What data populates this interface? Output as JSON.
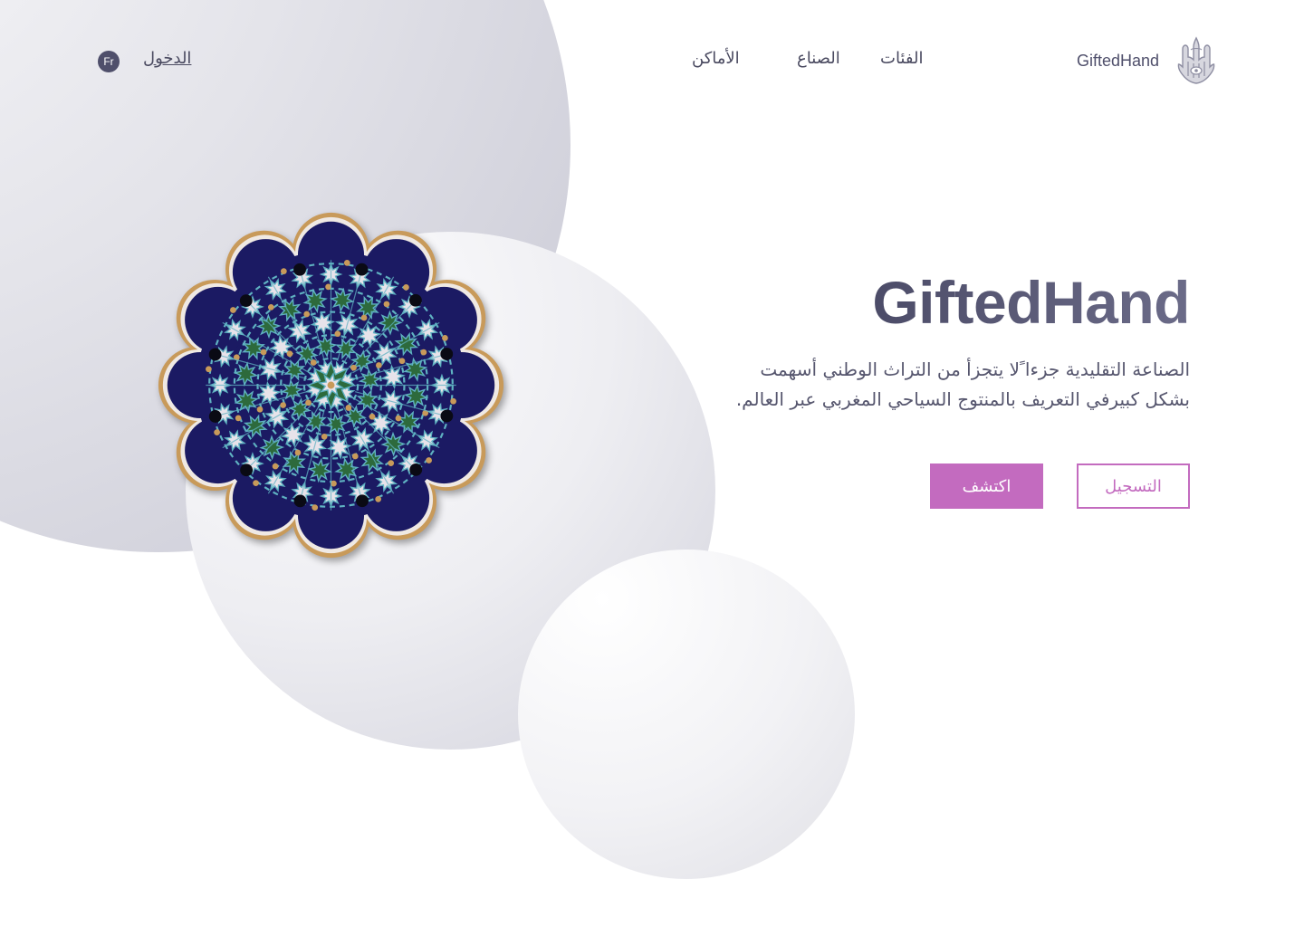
{
  "brand": {
    "name": "GiftedHand",
    "logo_icon": "hamsa-hand-icon"
  },
  "nav": {
    "items": [
      {
        "label": "الفئات"
      },
      {
        "label": "الصناع"
      },
      {
        "label": "الأماكن"
      }
    ],
    "login_label": "الدخول",
    "language_label": "Fr"
  },
  "hero": {
    "title": "GiftedHand",
    "description_line1": "الصناعة التقليدية جزءا ًلا يتجزأ من التراث الوطني أسهمت",
    "description_line2": "بشكل كبيرفي التعريف بالمنتوج السياحي المغربي عبر العالم.",
    "register_label": "التسجيل",
    "discover_label": "اكتشف",
    "image_icon": "moroccan-zellige-mosaic"
  },
  "colors": {
    "accent": "#c36bbf",
    "text_dark": "#4f4f6b",
    "mosaic_navy": "#1b1a63",
    "mosaic_green": "#2d6a3c",
    "mosaic_turquoise": "#5fb2c2",
    "mosaic_ochre": "#c89a5a"
  }
}
